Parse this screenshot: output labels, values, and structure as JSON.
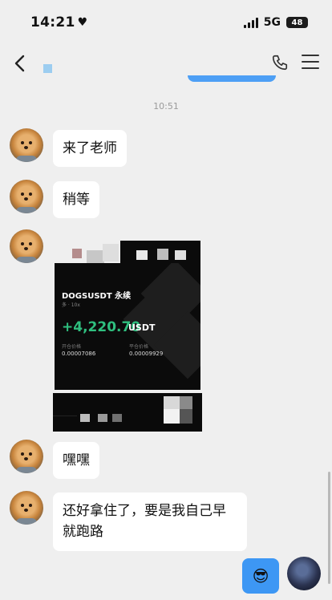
{
  "status_bar": {
    "time": "14:21",
    "heart_icon": "heart-icon",
    "network": "5G",
    "battery": "48"
  },
  "nav": {
    "back_icon": "chevron-left-icon",
    "phone_icon": "phone-icon",
    "menu_icon": "menu-icon"
  },
  "chat": {
    "timestamp": "10:51",
    "messages": [
      {
        "text": "来了老师"
      },
      {
        "text": "稍等"
      },
      {
        "text": "嘿嘿"
      },
      {
        "text": "还好拿住了，要是我自己早",
        "text_line2": "就跑路"
      }
    ],
    "trade_card": {
      "symbol": "DOGSUSDT 永续",
      "sub": "多 · 10x",
      "pnl": "+4,220.70",
      "unit": "USDT",
      "entry_label": "开仓价格",
      "entry_value": "0.00007086",
      "mark_label": "平仓价格",
      "mark_value": "0.00009929"
    },
    "sent_emoji": "😎"
  },
  "colors": {
    "background": "#efefef",
    "bubble_in": "#ffffff",
    "bubble_out": "#3d97f4",
    "pnl_green": "#2fbf7f"
  }
}
